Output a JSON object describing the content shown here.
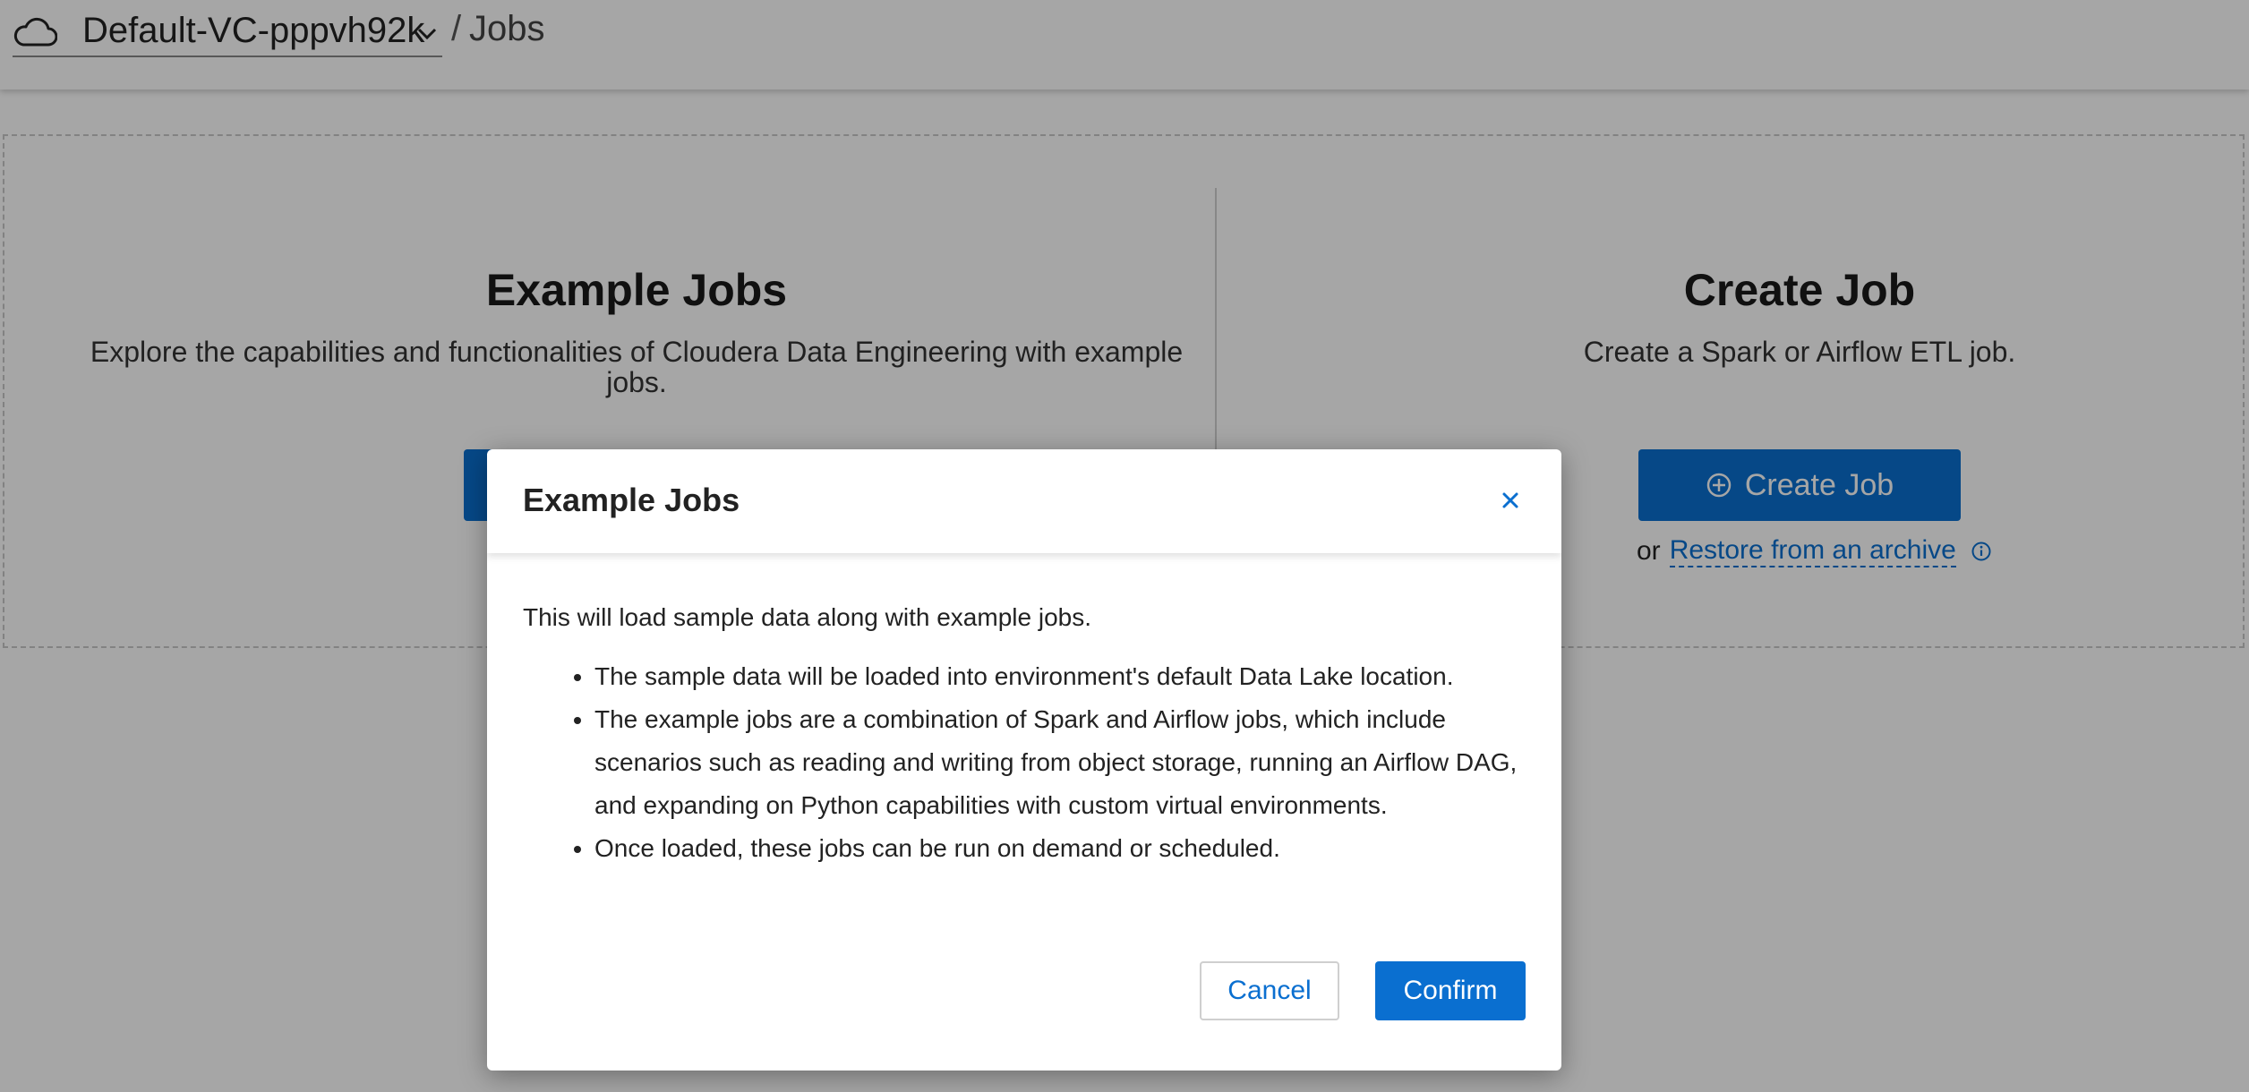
{
  "header": {
    "virtual_cluster": "Default-VC-pppvh92k",
    "separator": "/",
    "page": "Jobs"
  },
  "example_jobs": {
    "title": "Example Jobs",
    "description": "Explore the capabilities and functionalities of Cloudera Data Engineering with example jobs.",
    "button_label": ""
  },
  "create_job": {
    "title": "Create Job",
    "description": "Create a Spark or Airflow ETL job.",
    "button_label": "Create Job",
    "restore_prefix": "or",
    "restore_link": "Restore from an archive"
  },
  "modal": {
    "title": "Example Jobs",
    "intro": "This will load sample data along with example jobs.",
    "bullets": [
      "The sample data will be loaded into environment's default Data Lake location.",
      "The example jobs are a combination of Spark and Airflow jobs, which include scenarios such as reading and writing from object storage, running an Airflow DAG, and expanding on Python capabilities with custom virtual environments.",
      "Once loaded, these jobs can be run on demand or scheduled."
    ],
    "cancel_label": "Cancel",
    "confirm_label": "Confirm"
  },
  "colors": {
    "primary": "#0a6fd0",
    "overlay": "rgba(0,0,0,0.35)"
  },
  "icons": {
    "cluster": "cloud-icon",
    "dropdown": "chevron-down-icon",
    "create": "plus-circle-icon",
    "info": "info-icon",
    "close": "close-icon"
  }
}
